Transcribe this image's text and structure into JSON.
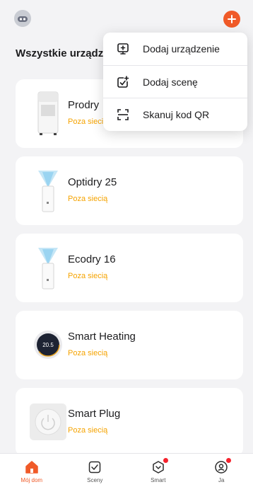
{
  "header": {
    "title": "Wszystkie urządzenia",
    "add_icon": "plus-icon",
    "avatar_icon": "avatar-icon"
  },
  "devices": [
    {
      "name": "Prodry",
      "status": "Poza siecią",
      "icon": "dehumidifier-icon"
    },
    {
      "name": "Optidry 25",
      "status": "Poza siecią",
      "icon": "air-purifier-icon"
    },
    {
      "name": "Ecodry 16",
      "status": "Poza siecią",
      "icon": "air-purifier-icon"
    },
    {
      "name": "Smart Heating",
      "status": "Poza siecią",
      "icon": "thermostat-icon"
    },
    {
      "name": "Smart Plug",
      "status": "Poza siecią",
      "icon": "plug-icon"
    }
  ],
  "thermostat_readout": "20.5",
  "menu": {
    "items": [
      {
        "label": "Dodaj urządzenie",
        "icon": "add-device-icon"
      },
      {
        "label": "Dodaj scenę",
        "icon": "add-scene-icon"
      },
      {
        "label": "Skanuj kod QR",
        "icon": "scan-qr-icon"
      }
    ]
  },
  "tabs": [
    {
      "label": "Mój dom",
      "icon": "home-icon",
      "active": true
    },
    {
      "label": "Sceny",
      "icon": "scenes-icon",
      "active": false
    },
    {
      "label": "Smart",
      "icon": "smart-icon",
      "active": false,
      "badge": true
    },
    {
      "label": "Ja",
      "icon": "profile-icon",
      "active": false,
      "badge": true
    }
  ],
  "colors": {
    "accent": "#f05a28",
    "status_offline": "#f5a300",
    "background": "#f3f3f5",
    "badge": "#f5222d"
  }
}
